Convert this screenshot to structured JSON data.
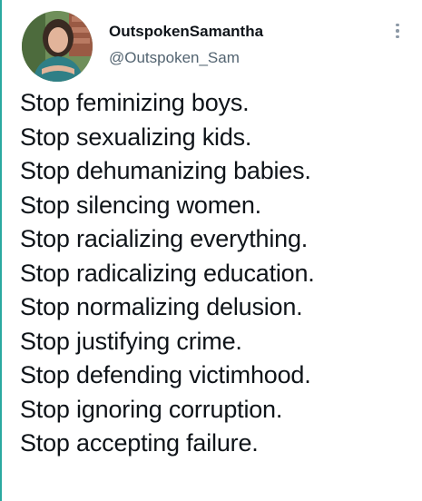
{
  "author": {
    "display_name": "OutspokenSamantha",
    "handle": "@Outspoken_Sam",
    "avatar_icon": "profile-photo"
  },
  "menu_icon": "vertical-ellipsis-icon",
  "colors": {
    "text": "#0f1419",
    "handle_text": "#536471",
    "left_accent_border": "#2aa9a0"
  },
  "tweet_lines": [
    "Stop feminizing boys.",
    "Stop sexualizing kids.",
    "Stop dehumanizing babies.",
    "Stop silencing women.",
    "Stop racializing everything.",
    "Stop radicalizing education.",
    "Stop normalizing delusion.",
    "Stop justifying crime.",
    "Stop defending victimhood.",
    "Stop ignoring corruption.",
    "Stop accepting failure."
  ]
}
